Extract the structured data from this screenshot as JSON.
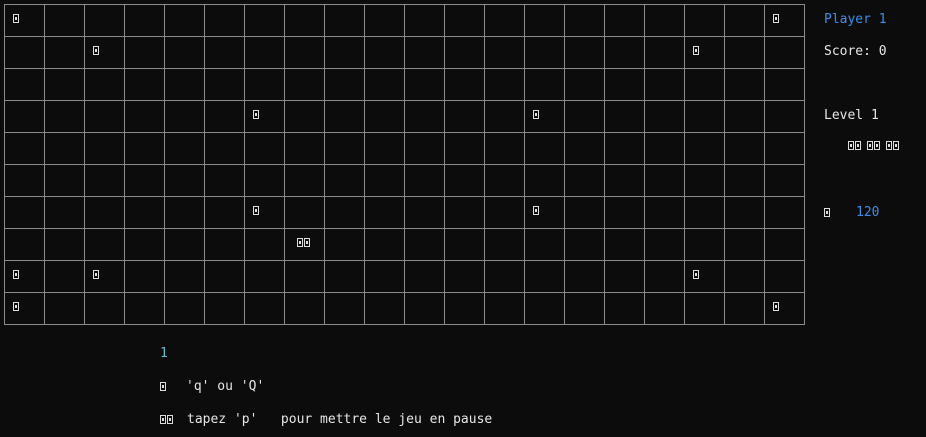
{
  "board": {
    "rows": 10,
    "cols": 20,
    "items": [
      {
        "r": 0,
        "c": 0,
        "icon": "box-glyph",
        "n": 1
      },
      {
        "r": 0,
        "c": 19,
        "icon": "box-glyph",
        "n": 1
      },
      {
        "r": 1,
        "c": 2,
        "icon": "box-glyph",
        "n": 1
      },
      {
        "r": 1,
        "c": 17,
        "icon": "box-glyph",
        "n": 1
      },
      {
        "r": 3,
        "c": 6,
        "icon": "box-glyph",
        "n": 1
      },
      {
        "r": 3,
        "c": 13,
        "icon": "box-glyph",
        "n": 1
      },
      {
        "r": 6,
        "c": 6,
        "icon": "box-glyph",
        "n": 1
      },
      {
        "r": 6,
        "c": 13,
        "icon": "box-glyph",
        "n": 1
      },
      {
        "r": 7,
        "c": 7,
        "icon": "player-glyph",
        "n": 2
      },
      {
        "r": 8,
        "c": 0,
        "icon": "box-glyph",
        "n": 1
      },
      {
        "r": 8,
        "c": 2,
        "icon": "box-glyph",
        "n": 1
      },
      {
        "r": 8,
        "c": 17,
        "icon": "box-glyph",
        "n": 1
      },
      {
        "r": 9,
        "c": 0,
        "icon": "box-glyph",
        "n": 1
      },
      {
        "r": 9,
        "c": 19,
        "icon": "box-glyph",
        "n": 1
      }
    ]
  },
  "panel": {
    "player": "Player 1",
    "score": "Score: 0",
    "level": "Level 1",
    "lives_icon": "heart-glyph",
    "lives": 3,
    "timer_icon": "clock-glyph",
    "timer": "120"
  },
  "footer": {
    "turn": "1",
    "quit_icon": "quit-glyph",
    "quit_text": "'q' ou 'Q'",
    "pause_icon": "pause-glyph",
    "pause_text": "tapez 'p'   pour mettre le jeu en pause"
  },
  "colors": {
    "background": "#0c0c0c",
    "grid": "#8a8a8a",
    "text": "#e6e6e6",
    "accent_blue": "#3b8eea",
    "accent_cyan": "#5fbfbf"
  }
}
